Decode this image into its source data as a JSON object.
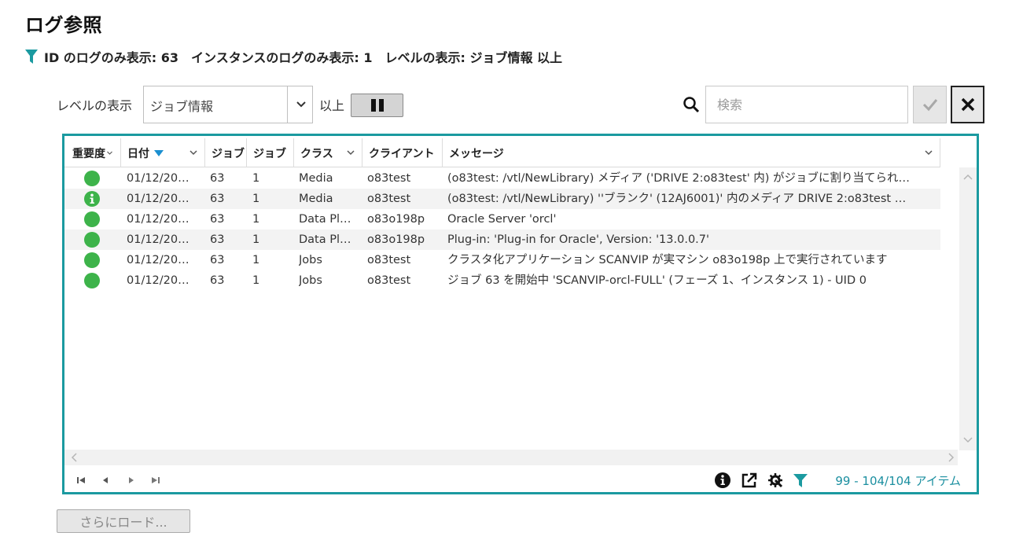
{
  "page": {
    "title": "ログ参照",
    "filter_summary": "ID のログのみ表示: 63　インスタンスのログのみ表示: 1　レベルの表示: ジョブ情報 以上"
  },
  "toolbar": {
    "level_label": "レベルの表示",
    "level_value": "ジョブ情報",
    "above_label": "以上",
    "search_placeholder": "検索"
  },
  "grid": {
    "columns": {
      "severity": "重要度",
      "date": "日付",
      "job1": "ジョブ",
      "job2": "ジョブ",
      "class": "クラス",
      "client": "クライアント",
      "message": "メッセージ"
    },
    "rows": [
      {
        "severity": "ok",
        "date": "01/12/20…",
        "job_id": "63",
        "instance": "1",
        "class": "Media",
        "client": "o83test",
        "message": "(o83test: /vtl/NewLibrary) メディア ('DRIVE 2:o83test' 内) がジョブに割り当てられ…"
      },
      {
        "severity": "info",
        "date": "01/12/20…",
        "job_id": "63",
        "instance": "1",
        "class": "Media",
        "client": "o83test",
        "message": "(o83test: /vtl/NewLibrary) ''ブランク' (12AJ6001)' 内のメディア DRIVE 2:o83test …"
      },
      {
        "severity": "ok",
        "date": "01/12/20…",
        "job_id": "63",
        "instance": "1",
        "class": "Data Pl…",
        "client": "o83o198p",
        "message": "Oracle Server 'orcl'"
      },
      {
        "severity": "ok",
        "date": "01/12/20…",
        "job_id": "63",
        "instance": "1",
        "class": "Data Pl…",
        "client": "o83o198p",
        "message": "Plug-in: 'Plug-in for Oracle', Version: '13.0.0.7'"
      },
      {
        "severity": "ok",
        "date": "01/12/20…",
        "job_id": "63",
        "instance": "1",
        "class": "Jobs",
        "client": "o83test",
        "message": "クラスタ化アプリケーション SCANVIP が実マシン o83o198p 上で実行されています"
      },
      {
        "severity": "ok",
        "date": "01/12/20…",
        "job_id": "63",
        "instance": "1",
        "class": "Jobs",
        "client": "o83test",
        "message": "ジョブ 63 を開始中 'SCANVIP-orcl-FULL' (フェーズ 1、インスタンス 1) - UID 0"
      }
    ],
    "item_count": "99 - 104/104 アイテム"
  },
  "footer": {
    "load_more_label": "さらにロード..."
  },
  "colors": {
    "accent": "#1b9aa0",
    "success": "#3db34a",
    "info": "#3db34a",
    "count_text": "#1b8fa0"
  },
  "icons": {
    "filter": "funnel-icon",
    "search": "magnifier-icon",
    "confirm": "checkmark-icon",
    "clear": "x-icon",
    "pause": "pause-icon",
    "info": "info-circle-icon",
    "export": "external-link-icon",
    "settings": "gear-wrench-icon"
  }
}
